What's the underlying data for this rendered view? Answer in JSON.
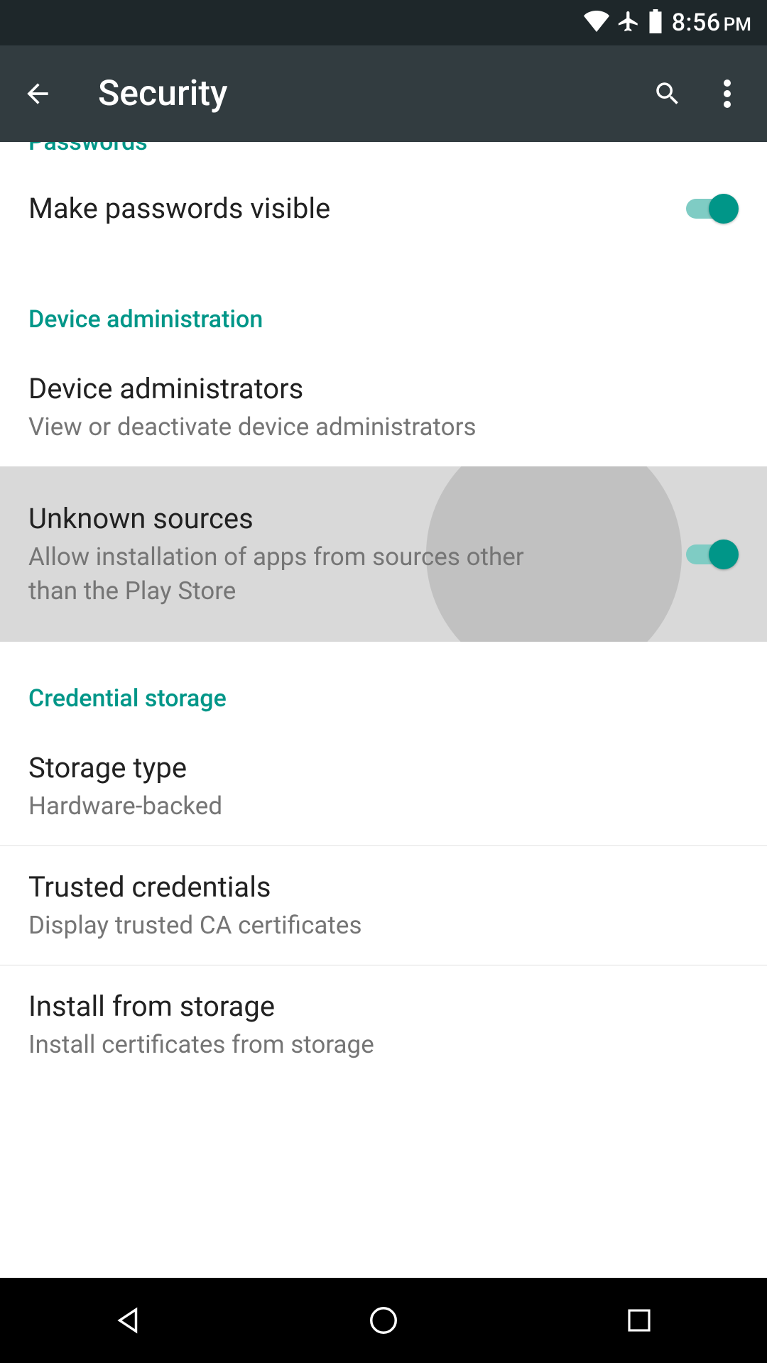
{
  "statusbar": {
    "time": "8:56",
    "ampm": "PM"
  },
  "appbar": {
    "title": "Security"
  },
  "sections": {
    "passwords": {
      "header": "Passwords",
      "make_visible": {
        "title": "Make passwords visible",
        "toggled": true
      }
    },
    "device_admin": {
      "header": "Device administration",
      "administrators": {
        "title": "Device administrators",
        "subtitle": "View or deactivate device administrators"
      },
      "unknown_sources": {
        "title": "Unknown sources",
        "subtitle": "Allow installation of apps from sources other than the Play Store",
        "toggled": true
      }
    },
    "credential_storage": {
      "header": "Credential storage",
      "storage_type": {
        "title": "Storage type",
        "subtitle": "Hardware-backed"
      },
      "trusted": {
        "title": "Trusted credentials",
        "subtitle": "Display trusted CA certificates"
      },
      "install": {
        "title": "Install from storage",
        "subtitle": "Install certificates from storage"
      }
    }
  },
  "colors": {
    "accent": "#009688",
    "appbar": "#323c40",
    "statusbar": "#1e272a"
  }
}
